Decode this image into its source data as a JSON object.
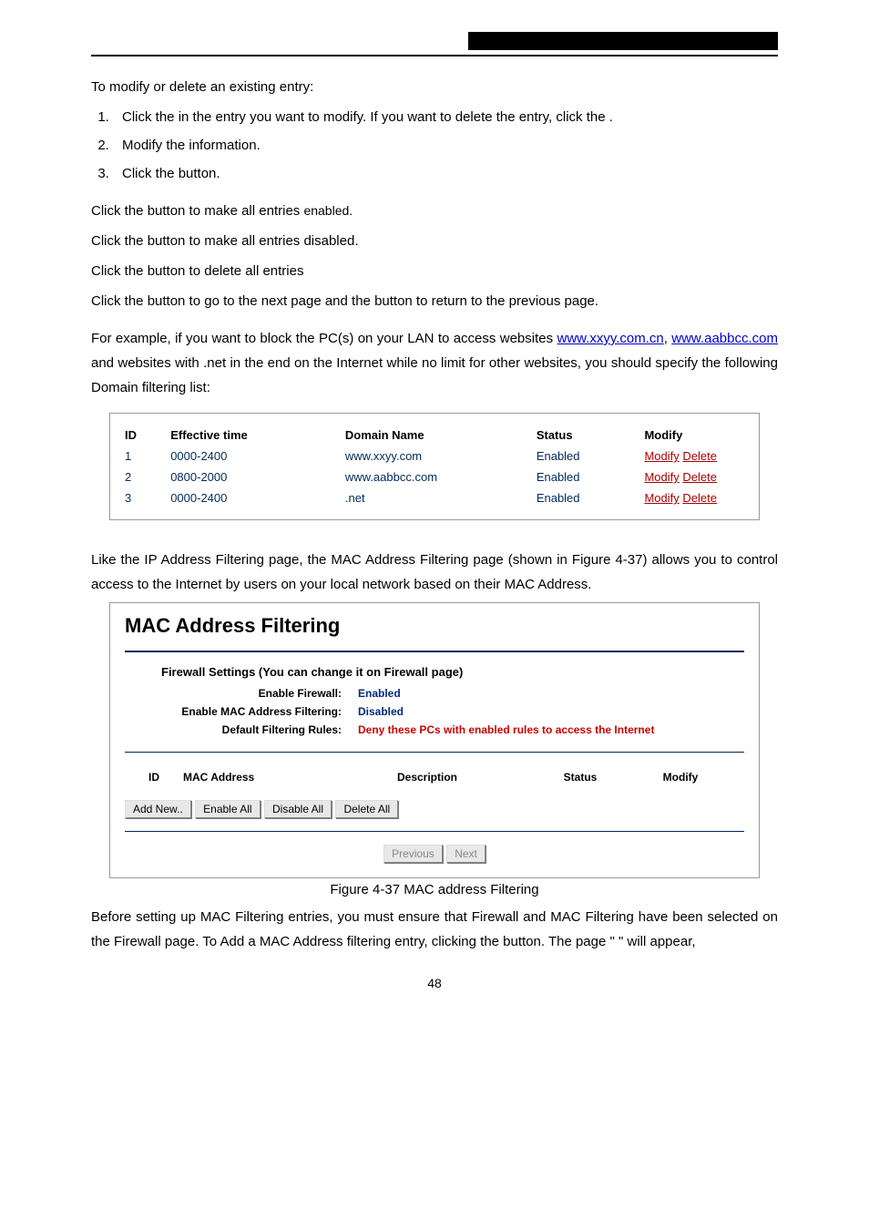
{
  "intro_modify": "To modify or delete an existing entry:",
  "ol_1_a": "Click the ",
  "ol_1_b": " in the entry you want to modify. If you want to delete the entry, click the ",
  "ol_1_c": ".",
  "ol_2": "Modify the information.",
  "ol_3_a": "Click the ",
  "ol_3_b": " button.",
  "p_enable_a": "Click the ",
  "p_enable_b": " button to make all entries ",
  "p_enable_c": "enabled.",
  "p_disable_a": "Click the ",
  "p_disable_b": " button to make all entries disabled.",
  "p_delete_a": "Click the ",
  "p_delete_b": " button to delete all entries",
  "p_nav_a": "Click the ",
  "p_nav_b": " button to go to the next page and the ",
  "p_nav_c": " button to return to the previous page.",
  "p_example_a": "For example, if you want to block the PC(s) on your LAN to access websites ",
  "p_example_link1": "www.xxyy.com.cn",
  "p_example_b": ", ",
  "p_example_link2": "www.aabbcc.com",
  "p_example_c": " and websites with .net in the end on the Internet while no limit for other websites, you should specify the following Domain filtering list:",
  "dtable": {
    "h1": "ID",
    "h2": "Effective time",
    "h3": "Domain Name",
    "h4": "Status",
    "h5": "Modify",
    "rows": [
      {
        "id": "1",
        "time": "0000-2400",
        "domain": "www.xxyy.com",
        "status": "Enabled",
        "modify": "Modify",
        "delete": "Delete"
      },
      {
        "id": "2",
        "time": "0800-2000",
        "domain": "www.aabbcc.com",
        "status": "Enabled",
        "modify": "Modify",
        "delete": "Delete"
      },
      {
        "id": "3",
        "time": "0000-2400",
        "domain": ".net",
        "status": "Enabled",
        "modify": "Modify",
        "delete": "Delete"
      }
    ]
  },
  "p_like": "Like the IP Address Filtering page, the MAC Address Filtering page (shown in Figure 4-37) allows you to control access to the Internet by users on your local network based on their MAC Address.",
  "mac": {
    "title": "MAC Address Filtering",
    "fw_heading": "Firewall Settings (You can change it on Firewall page)",
    "lbl_enable_fw": "Enable Firewall:",
    "val_enable_fw": "Enabled",
    "lbl_enable_mac": "Enable MAC Address Filtering:",
    "val_enable_mac": "Disabled",
    "lbl_rules": "Default Filtering Rules:",
    "val_rules": "Deny these PCs with enabled rules to access the Internet",
    "h_id": "ID",
    "h_mac": "MAC Address",
    "h_desc": "Description",
    "h_status": "Status",
    "h_modify": "Modify",
    "btn_add": "Add New..",
    "btn_enable": "Enable All",
    "btn_disable": "Disable All",
    "btn_delete": "Delete All",
    "btn_prev": "Previous",
    "btn_next": "Next"
  },
  "caption": "Figure 4-37    MAC address Filtering",
  "p_before_a": "Before setting up MAC Filtering entries, you must ensure that ",
  "p_before_b": " Firewall and ",
  "p_before_c": " MAC Filtering have been selected on the Firewall page. To Add a MAC Address filtering entry, clicking the ",
  "p_before_d": " button. The page \"",
  "p_before_e": "\" will appear,",
  "pagenum": "48"
}
